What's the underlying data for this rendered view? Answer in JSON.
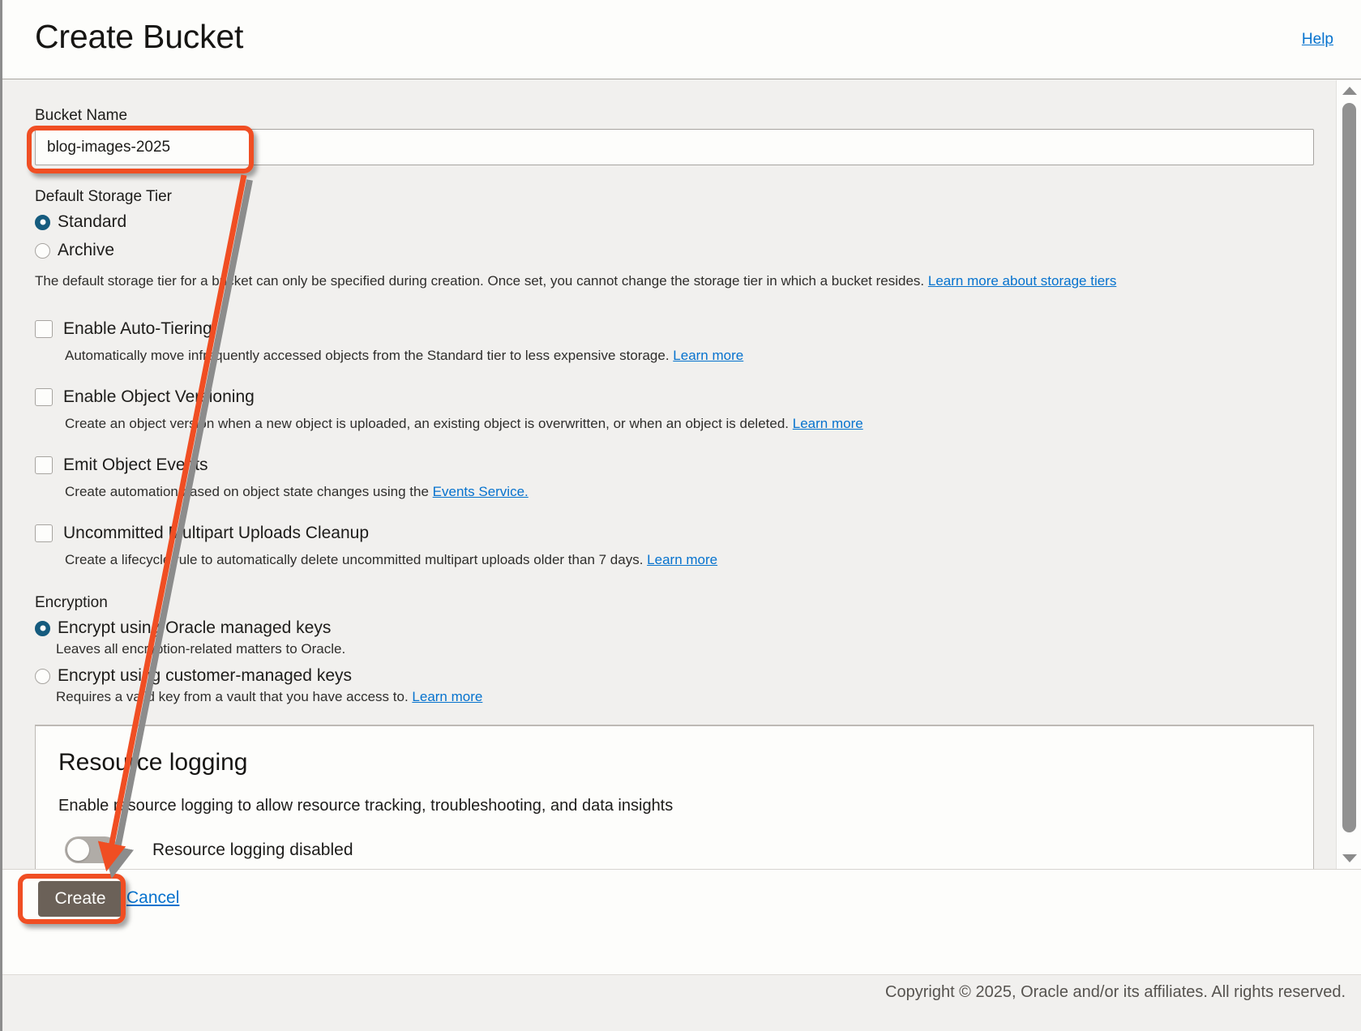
{
  "header": {
    "title": "Create Bucket",
    "help_label": "Help"
  },
  "form": {
    "bucket_name": {
      "label": "Bucket Name",
      "value": "blog-images-2025",
      "placeholder": ""
    },
    "default_storage_tier": {
      "label": "Default Storage Tier",
      "options": [
        {
          "label": "Standard",
          "selected": true
        },
        {
          "label": "Archive",
          "selected": false
        }
      ],
      "help_text": "The default storage tier for a bucket can only be specified during creation. Once set, you cannot change the storage tier in which a bucket resides.",
      "help_link": "Learn more about storage tiers"
    },
    "checkboxes": [
      {
        "label": "Enable Auto-Tiering",
        "checked": false,
        "help_text": "Automatically move infrequently accessed objects from the Standard tier to less expensive storage.",
        "help_link": "Learn more",
        "help_text_tail": ""
      },
      {
        "label": "Enable Object Versioning",
        "checked": false,
        "help_text": "Create an object version when a new object is uploaded, an existing object is overwritten, or when an object is deleted.",
        "help_link": "Learn more",
        "help_text_tail": ""
      },
      {
        "label": "Emit Object Events",
        "checked": false,
        "help_text": "Create automation based on object state changes using the",
        "help_link": "Events Service.",
        "help_text_tail": ""
      },
      {
        "label": "Uncommitted Multipart Uploads Cleanup",
        "checked": false,
        "help_text": "Create a lifecycle rule to automatically delete uncommitted multipart uploads older than 7 days.",
        "help_link": "Learn more",
        "help_text_tail": ""
      }
    ],
    "encryption": {
      "label": "Encryption",
      "options": [
        {
          "label": "Encrypt using Oracle managed keys",
          "selected": true,
          "help_text": "Leaves all encryption-related matters to Oracle.",
          "help_link": "",
          "help_text_tail": ""
        },
        {
          "label": "Encrypt using customer-managed keys",
          "selected": false,
          "help_text": "Requires a valid key from a vault that you have access to.",
          "help_link": "Learn more",
          "help_text_tail": ""
        }
      ]
    },
    "resource_logging": {
      "title": "Resource logging",
      "subtitle": "Enable resource logging to allow resource tracking, troubleshooting, and data insights",
      "toggle_label": "Resource logging disabled",
      "toggle_on": false
    }
  },
  "actions": {
    "create_label": "Create",
    "cancel_label": "Cancel"
  },
  "footer": {
    "copyright": "Copyright © 2025, Oracle and/or its affiliates. All rights reserved."
  },
  "annotation": {
    "color": "#f04e23",
    "highlights": [
      "bucket-name-input",
      "create-button"
    ],
    "arrow_from": "bucket-name-input",
    "arrow_to": "resource-logging-toggle"
  },
  "colors": {
    "accent_link": "#0572ce",
    "radio_selected": "#155b7e",
    "annotation": "#f04e23",
    "create_button": "#6b6158",
    "page_background": "#f1f0ee"
  }
}
